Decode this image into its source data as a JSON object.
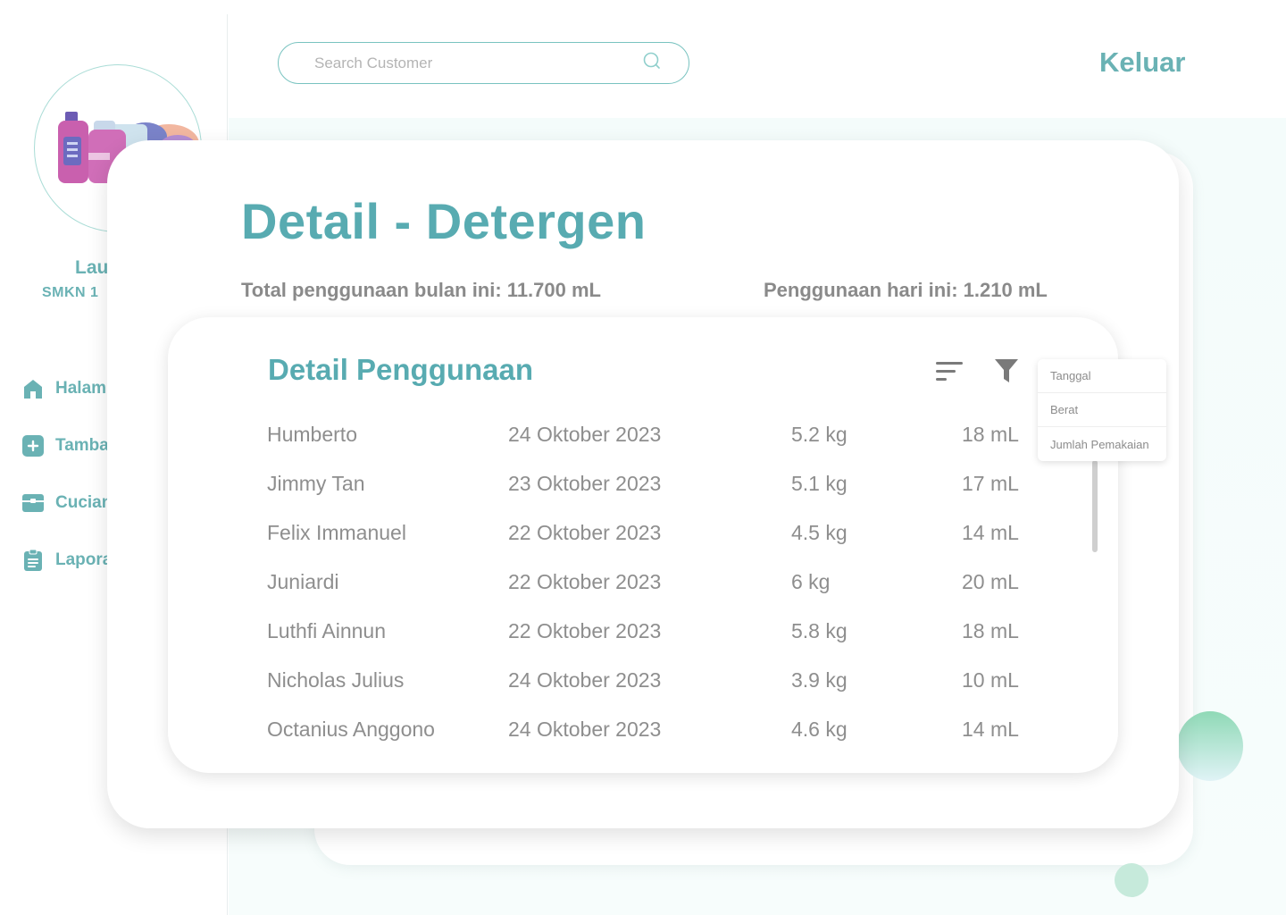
{
  "sidebar": {
    "app_name": "Lau",
    "app_subtitle": "SMKN 1",
    "nav_items": [
      {
        "label": "Halam",
        "icon": "home-icon"
      },
      {
        "label": "Tamba",
        "icon": "plus-square-icon"
      },
      {
        "label": "Cucian",
        "icon": "box-icon"
      },
      {
        "label": "Lapora",
        "icon": "clipboard-icon"
      }
    ]
  },
  "header": {
    "search_placeholder": "Search Customer",
    "search_icon": "search-icon",
    "logout_label": "Keluar"
  },
  "modal": {
    "title": "Detail - Detergen",
    "total_month": "Total penggunaan bulan ini: 11.700 mL",
    "today": "Penggunaan hari ini: 1.210 mL",
    "usage": {
      "title": "Detail Penggunaan",
      "sort_icon": "sort-icon",
      "filter_icon": "filter-icon",
      "rows": [
        {
          "name": "Humberto",
          "date": "24 Oktober 2023",
          "weight": "5.2 kg",
          "amount": "18 mL"
        },
        {
          "name": "Jimmy Tan",
          "date": "23 Oktober 2023",
          "weight": "5.1 kg",
          "amount": "17 mL"
        },
        {
          "name": "Felix Immanuel",
          "date": "22 Oktober 2023",
          "weight": "4.5 kg",
          "amount": "14 mL"
        },
        {
          "name": "Juniardi",
          "date": "22 Oktober 2023",
          "weight": "6 kg",
          "amount": "20 mL"
        },
        {
          "name": "Luthfi Ainnun",
          "date": "22 Oktober 2023",
          "weight": "5.8 kg",
          "amount": "18 mL"
        },
        {
          "name": "Nicholas Julius",
          "date": "24 Oktober 2023",
          "weight": "3.9 kg",
          "amount": "10 mL"
        },
        {
          "name": "Octanius Anggono",
          "date": "24 Oktober 2023",
          "weight": "4.6 kg",
          "amount": "14 mL"
        }
      ]
    },
    "sort_menu": [
      "Tanggal",
      "Berat",
      "Jumlah Pemakaian"
    ]
  },
  "colors": {
    "accent": "#58abb1",
    "nav": "#6ab2b4",
    "text": "#8e8e8e"
  }
}
